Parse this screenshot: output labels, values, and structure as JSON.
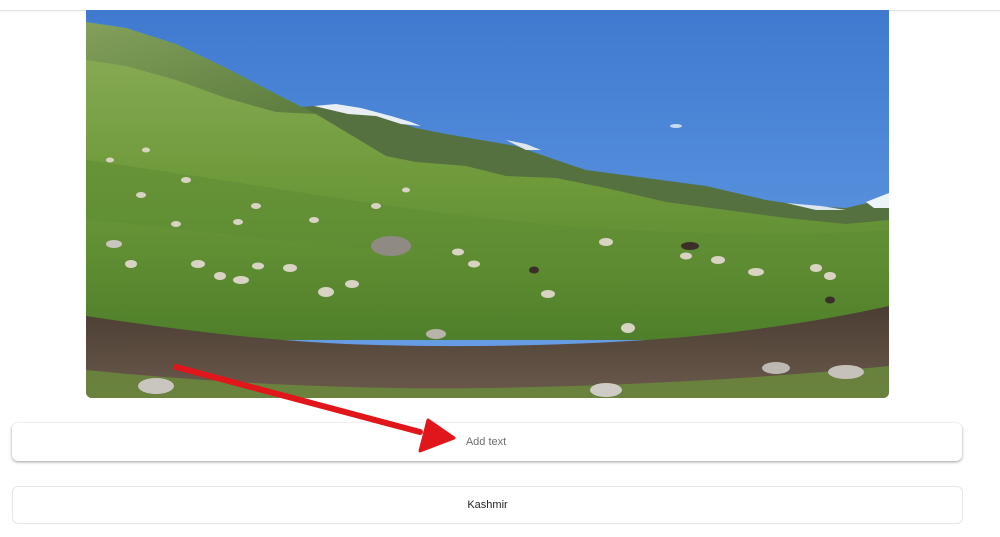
{
  "photo": {
    "icon": "landscape-photo"
  },
  "caption": {
    "placeholder": "Add text"
  },
  "location": {
    "value": "Kashmir"
  },
  "colors": {
    "sky": "#4c86d6",
    "grass": "#6f9a3a",
    "soil": "#5a4a3e",
    "arrow": "#e0161b"
  }
}
